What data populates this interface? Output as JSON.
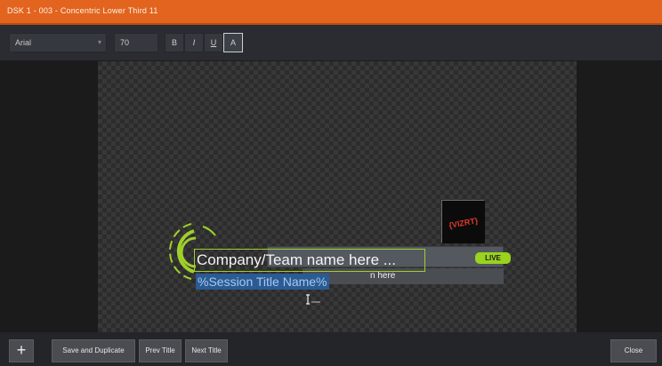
{
  "window": {
    "title": "DSK 1 - 003 - Concentric Lower Third 11"
  },
  "toolbar": {
    "font_family": "Arial",
    "font_size": "70",
    "bold_label": "B",
    "italic_label": "I",
    "underline_label": "U",
    "all_caps_label": "A"
  },
  "canvas": {
    "main_text": "Company/Team name here ...",
    "session_text": "%Session Title Name%",
    "subtitle_fragment": "n here",
    "live_badge": "LIVE",
    "logo_text": "{VIZRT}"
  },
  "footer": {
    "add_label": "+",
    "save_duplicate_label": "Save and Duplicate",
    "prev_title_label": "Prev Title",
    "next_title_label": "Next Title",
    "close_label": "Close"
  },
  "colors": {
    "titlebar": "#e2641f",
    "accent_green": "#9fcf2a",
    "selection_blue": "#2a5b93"
  }
}
